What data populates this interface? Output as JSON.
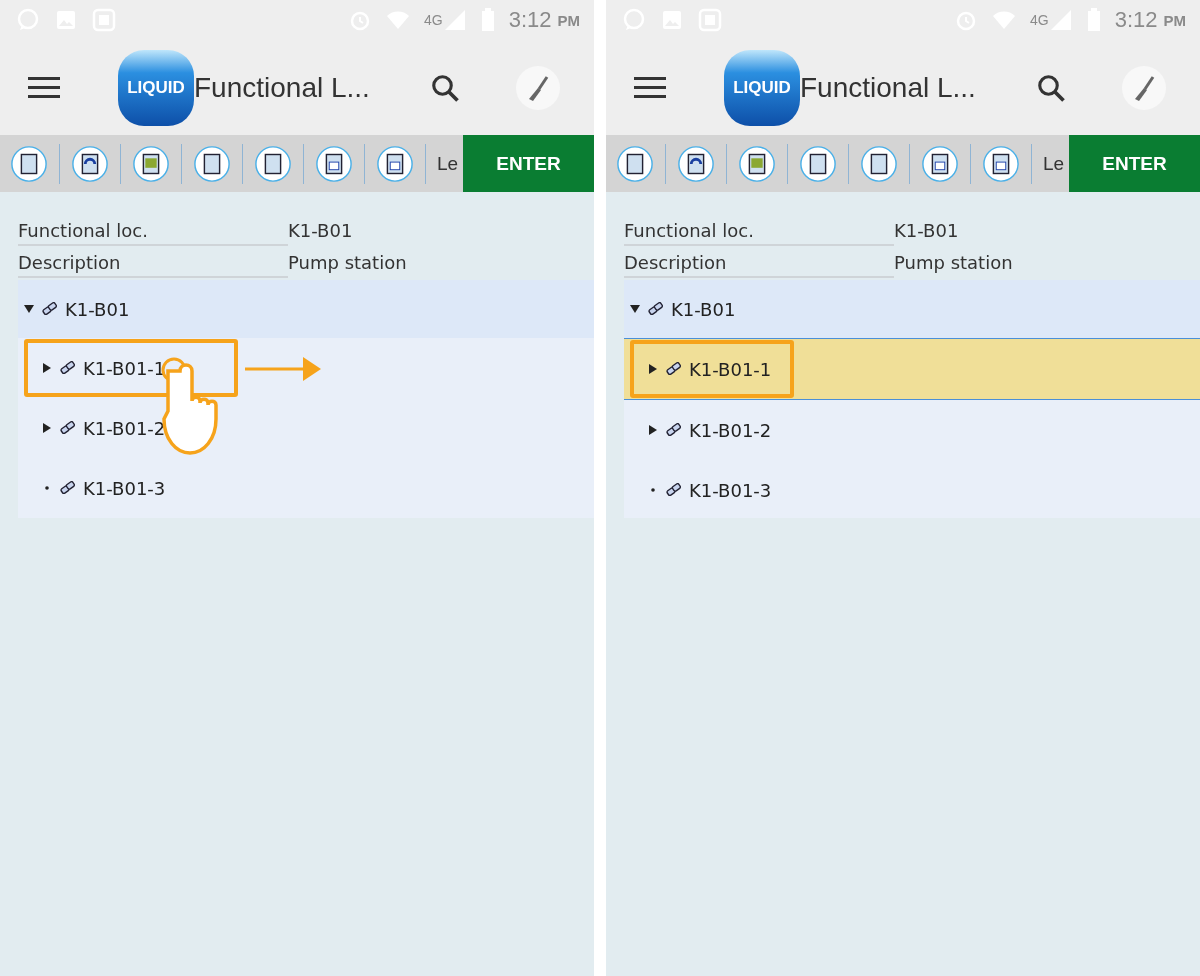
{
  "panels": [
    {
      "status_bar": {
        "network": "4G",
        "time": "3:12",
        "ampm": "PM"
      },
      "app_bar": {
        "logo": "LIQUID",
        "title": "Functional L..."
      },
      "toolbar": {
        "cut_label": "Le",
        "enter_button": "ENTER"
      },
      "fields": [
        {
          "label": "Functional loc.",
          "value": "K1-B01"
        },
        {
          "label": "Description",
          "value": "Pump station"
        }
      ],
      "tree": [
        {
          "label": "K1-B01",
          "kind": "branch",
          "expanded": true,
          "selected": false,
          "highlighted": false,
          "children": [
            {
              "label": "K1-B01-1",
              "kind": "branch",
              "expanded": false,
              "selected": false,
              "highlighted": true
            },
            {
              "label": "K1-B01-2",
              "kind": "branch",
              "expanded": false,
              "selected": false,
              "highlighted": false
            },
            {
              "label": "K1-B01-3",
              "kind": "leaf",
              "expanded": false,
              "selected": false,
              "highlighted": false
            }
          ]
        }
      ],
      "tap_hint": true
    },
    {
      "status_bar": {
        "network": "4G",
        "time": "3:12",
        "ampm": "PM"
      },
      "app_bar": {
        "logo": "LIQUID",
        "title": "Functional L..."
      },
      "toolbar": {
        "cut_label": "Le",
        "enter_button": "ENTER"
      },
      "fields": [
        {
          "label": "Functional loc.",
          "value": "K1-B01"
        },
        {
          "label": "Description",
          "value": "Pump station"
        }
      ],
      "tree": [
        {
          "label": "K1-B01",
          "kind": "branch",
          "expanded": true,
          "selected": false,
          "highlighted": false,
          "children": [
            {
              "label": "K1-B01-1",
              "kind": "branch",
              "expanded": false,
              "selected": true,
              "highlighted": true
            },
            {
              "label": "K1-B01-2",
              "kind": "branch",
              "expanded": false,
              "selected": false,
              "highlighted": false
            },
            {
              "label": "K1-B01-3",
              "kind": "leaf",
              "expanded": false,
              "selected": false,
              "highlighted": false
            }
          ]
        }
      ],
      "tap_hint": false
    }
  ]
}
